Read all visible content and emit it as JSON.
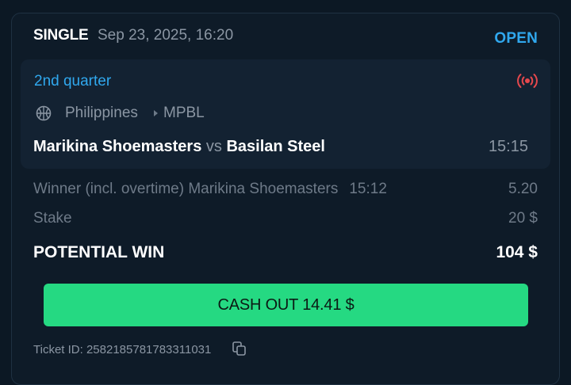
{
  "bet": {
    "type": "SINGLE",
    "date": "Sep 23, 2025, 16:20",
    "status": "OPEN"
  },
  "event": {
    "period": "2nd quarter",
    "live_icon": "live-broadcast-icon",
    "sport_icon": "basketball-icon",
    "country": "Philippines",
    "league": "MPBL",
    "home_team": "Marikina Shoemasters",
    "vs": "vs",
    "away_team": "Basilan Steel",
    "time": "15:15"
  },
  "selection": {
    "market": "Winner (incl. overtime) Marikina Shoemasters",
    "time": "15:12",
    "odds": "5.20"
  },
  "stake": {
    "label": "Stake",
    "value": "20 $"
  },
  "potential_win": {
    "label": "POTENTIAL WIN",
    "value": "104 $"
  },
  "cashout": {
    "label": "CASH OUT 14.41 $"
  },
  "ticket": {
    "label": "Ticket ID: 2582185781783311031",
    "copy_icon": "copy-icon"
  },
  "colors": {
    "accent_blue": "#30a8ee",
    "cashout_green": "#25d982",
    "live_red": "#e5484d",
    "background": "#0c1824"
  }
}
